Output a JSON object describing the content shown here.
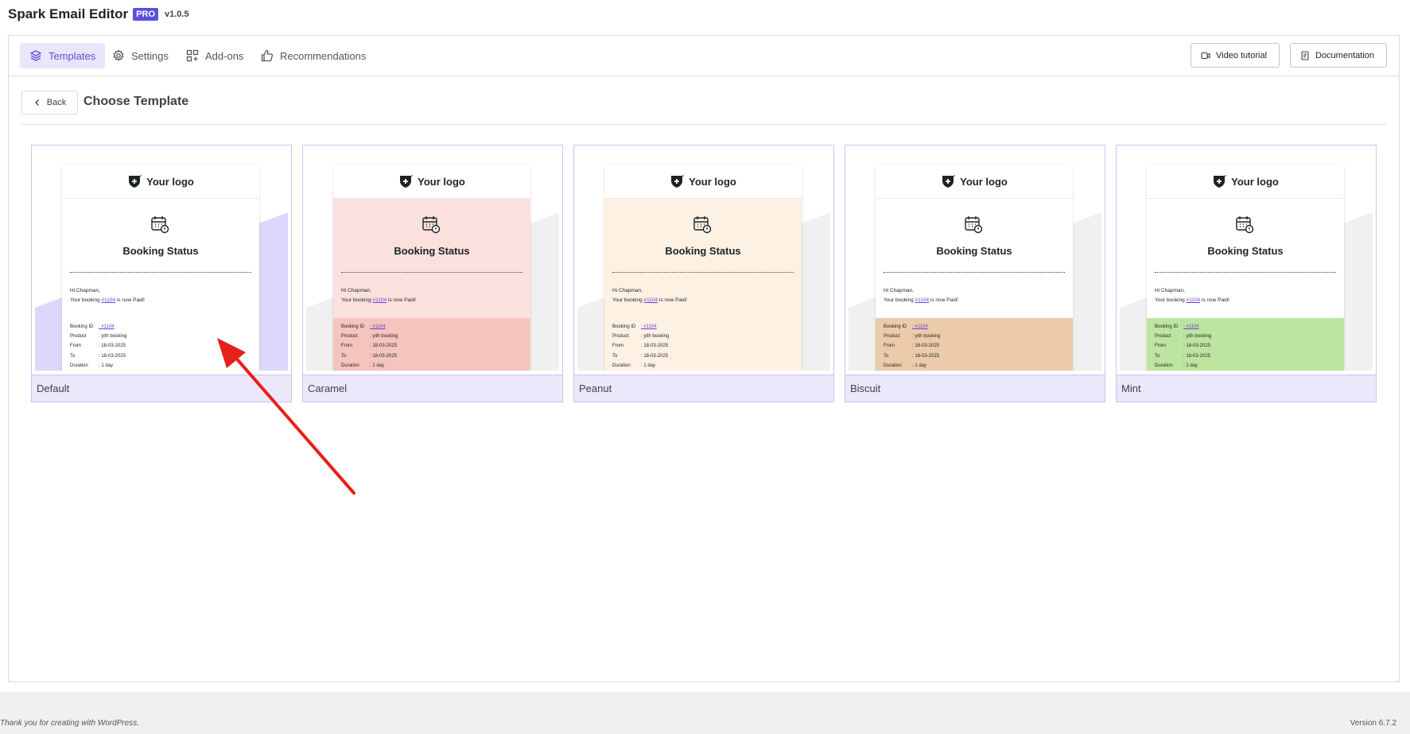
{
  "app": {
    "name": "Spark Email Editor",
    "badge": "PRO",
    "version": "v1.0.5"
  },
  "nav": {
    "tabs": [
      {
        "label": "Templates",
        "icon": "layers-icon",
        "active": true
      },
      {
        "label": "Settings",
        "icon": "gear-icon"
      },
      {
        "label": "Add-ons",
        "icon": "add-ons-icon"
      },
      {
        "label": "Recommendations",
        "icon": "thumbs-up-icon"
      }
    ],
    "video_tutorial": "Video tutorial",
    "documentation": "Documentation"
  },
  "page": {
    "back_label": "Back",
    "title": "Choose Template"
  },
  "email_preview": {
    "logo_text": "Your logo",
    "status": "Booking Status",
    "greeting": "Hi Chapman,",
    "message_pre": "Your booking ",
    "booking_link": "#1104",
    "message_post": " is now Paid!",
    "rows": [
      {
        "k": "Booking ID",
        "v": ": #1104"
      },
      {
        "k": "Product",
        "v": ": yith booking"
      },
      {
        "k": "From",
        "v": ": 18-03-2025"
      },
      {
        "k": "To",
        "v": ": 18-03-2025"
      },
      {
        "k": "Duration",
        "v": ": 1 day"
      }
    ]
  },
  "templates": [
    {
      "name": "Default",
      "hero_bg": "#ffffff",
      "details_bg": "#ffffff",
      "bg_accent": "#dcd8fb"
    },
    {
      "name": "Caramel",
      "hero_bg": "#fae1de",
      "details_bg": "#f4c4bd",
      "bg_accent": "#f0f0f0"
    },
    {
      "name": "Peanut",
      "hero_bg": "#fdf1e3",
      "details_bg": "#fdf1e3",
      "bg_accent": "#f0f0f0"
    },
    {
      "name": "Biscuit",
      "hero_bg": "#ffffff",
      "details_bg": "#ebcba9",
      "bg_accent": "#f0f0f0"
    },
    {
      "name": "Mint",
      "hero_bg": "#ffffff",
      "details_bg": "#bde5a0",
      "bg_accent": "#f0f0f0"
    }
  ],
  "colors": {
    "accent": "#5b4fdb",
    "arrow": "#e8201a"
  },
  "footer": {
    "thanks": "Thank you for creating with WordPress.",
    "version": "Version 6.7.2"
  }
}
